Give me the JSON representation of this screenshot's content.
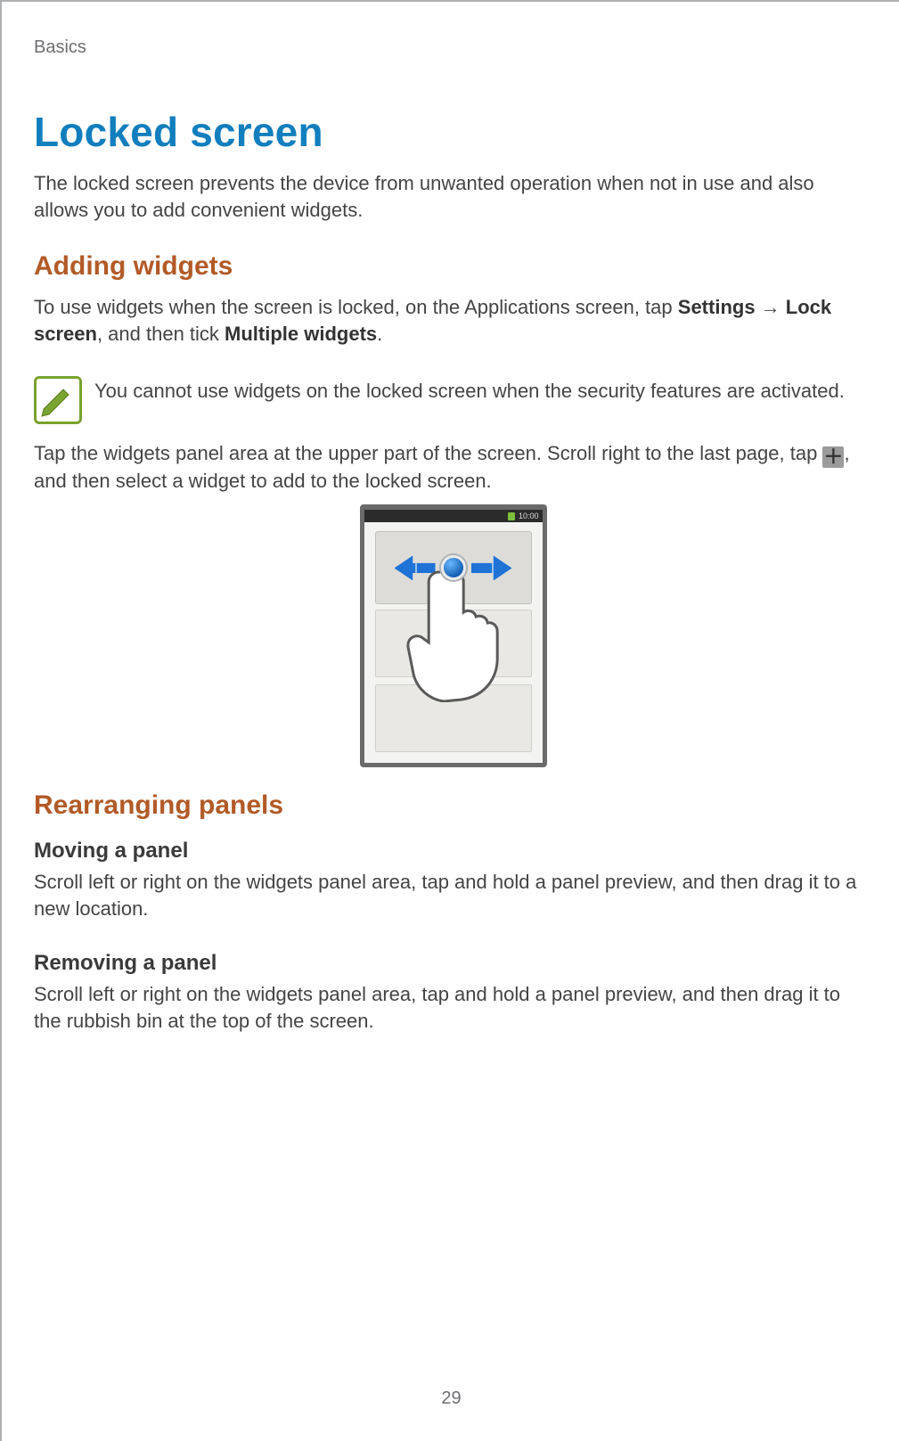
{
  "breadcrumb": "Basics",
  "title": "Locked screen",
  "intro": "The locked screen prevents the device from unwanted operation when not in use and also allows you to add convenient widgets.",
  "section_adding": {
    "heading": "Adding widgets",
    "p1_pre": "To use widgets when the screen is locked, on the Applications screen, tap ",
    "p1_b1": "Settings",
    "p1_arrow": " → ",
    "p1_b2": "Lock screen",
    "p1_mid": ", and then tick ",
    "p1_b3": "Multiple widgets",
    "p1_end": ".",
    "note": "You cannot use widgets on the locked screen when the security features are activated.",
    "p2_pre": "Tap the widgets panel area at the upper part of the screen. Scroll right to the last page, tap ",
    "p2_end": ", and then select a widget to add to the locked screen."
  },
  "illustration": {
    "statusbar_time": "10:00"
  },
  "section_rearranging": {
    "heading": "Rearranging panels",
    "moving_heading": "Moving a panel",
    "moving_body": "Scroll left or right on the widgets panel area, tap and hold a panel preview, and then drag it to a new location.",
    "removing_heading": "Removing a panel",
    "removing_body": "Scroll left or right on the widgets panel area, tap and hold a panel preview, and then drag it to the rubbish bin at the top of the screen."
  },
  "page_number": "29"
}
